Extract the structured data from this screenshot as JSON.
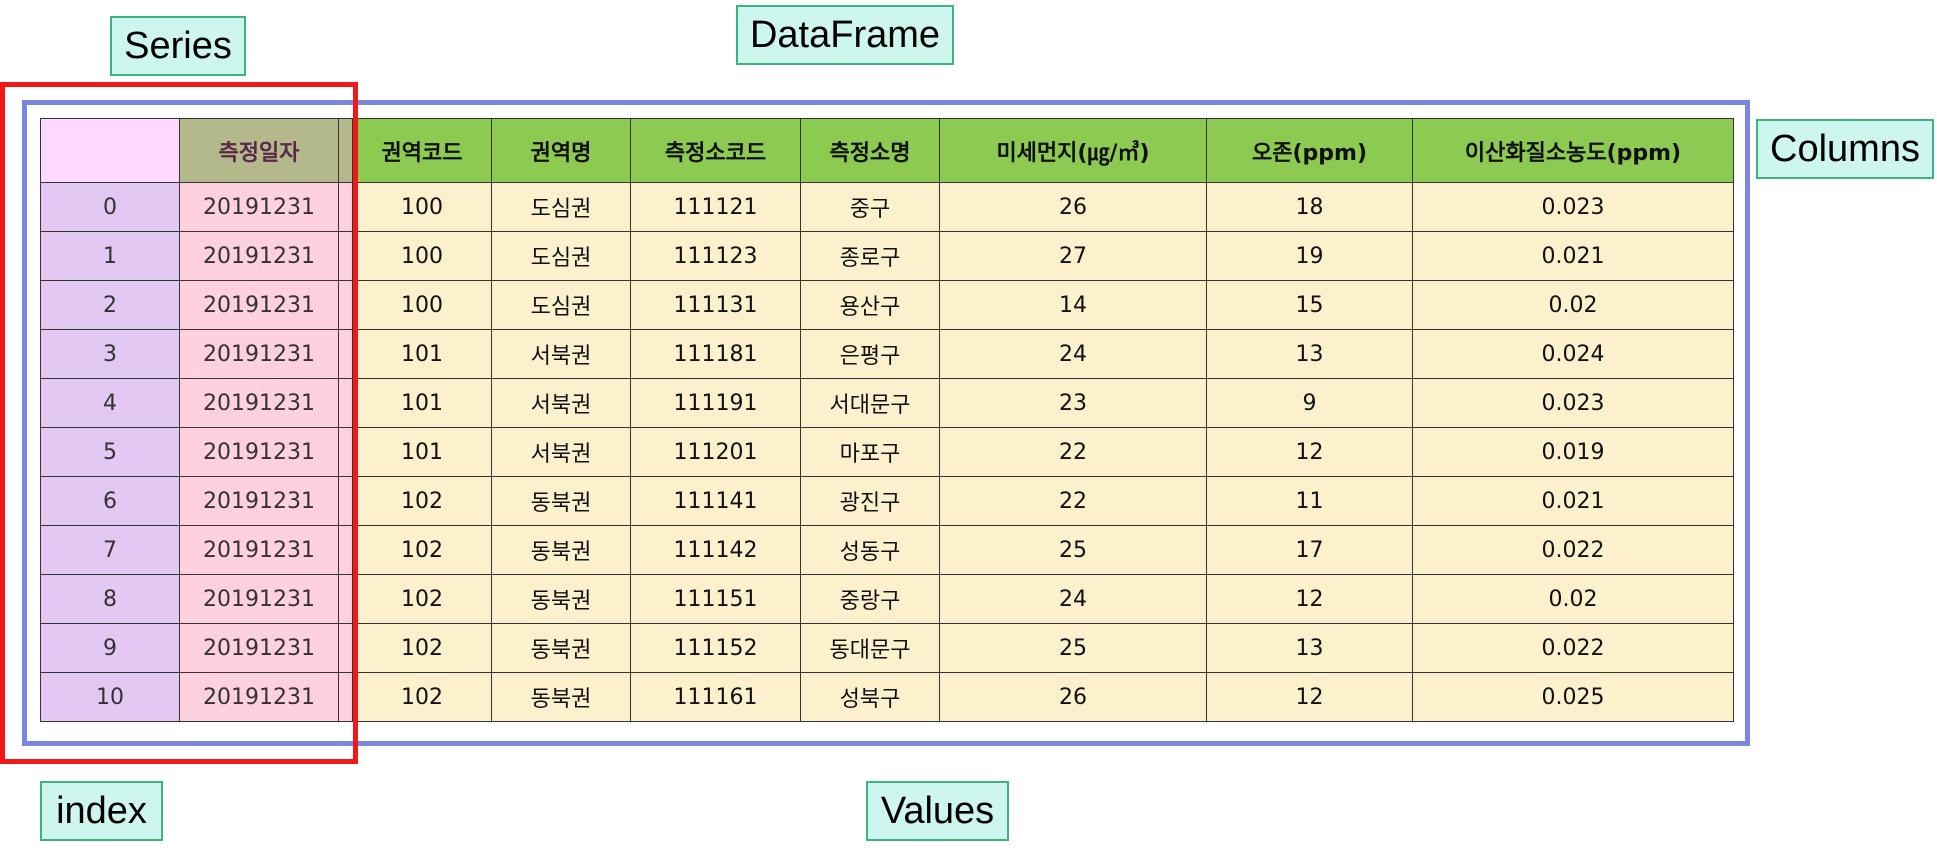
{
  "labels": {
    "series": "Series",
    "dataframe": "DataFrame",
    "columns": "Columns",
    "index": "index",
    "values": "Values"
  },
  "colors": {
    "label_bg": "#cdf6ee",
    "label_border": "#3cb47f",
    "dataframe_border": "#7b86e0",
    "series_border": "#f01818",
    "header_bg": "#8cca51",
    "values_bg": "#fdf1cd",
    "index_bg": "#e3c8f4",
    "series_bg": "#ffd1de"
  },
  "table": {
    "headers": [
      "측정일자",
      "권역코드",
      "권역명",
      "측정소코드",
      "측정소명",
      "미세먼지(㎍/㎥)",
      "오존(ppm)",
      "이산화질소농도(ppm)"
    ],
    "rows": [
      {
        "index": "0",
        "cells": [
          "20191231",
          "100",
          "도심권",
          "111121",
          "중구",
          "26",
          "18",
          "0.023"
        ]
      },
      {
        "index": "1",
        "cells": [
          "20191231",
          "100",
          "도심권",
          "111123",
          "종로구",
          "27",
          "19",
          "0.021"
        ]
      },
      {
        "index": "2",
        "cells": [
          "20191231",
          "100",
          "도심권",
          "111131",
          "용산구",
          "14",
          "15",
          "0.02"
        ]
      },
      {
        "index": "3",
        "cells": [
          "20191231",
          "101",
          "서북권",
          "111181",
          "은평구",
          "24",
          "13",
          "0.024"
        ]
      },
      {
        "index": "4",
        "cells": [
          "20191231",
          "101",
          "서북권",
          "111191",
          "서대문구",
          "23",
          "9",
          "0.023"
        ]
      },
      {
        "index": "5",
        "cells": [
          "20191231",
          "101",
          "서북권",
          "111201",
          "마포구",
          "22",
          "12",
          "0.019"
        ]
      },
      {
        "index": "6",
        "cells": [
          "20191231",
          "102",
          "동북권",
          "111141",
          "광진구",
          "22",
          "11",
          "0.021"
        ]
      },
      {
        "index": "7",
        "cells": [
          "20191231",
          "102",
          "동북권",
          "111142",
          "성동구",
          "25",
          "17",
          "0.022"
        ]
      },
      {
        "index": "8",
        "cells": [
          "20191231",
          "102",
          "동북권",
          "111151",
          "중랑구",
          "24",
          "12",
          "0.02"
        ]
      },
      {
        "index": "9",
        "cells": [
          "20191231",
          "102",
          "동북권",
          "111152",
          "동대문구",
          "25",
          "13",
          "0.022"
        ]
      },
      {
        "index": "10",
        "cells": [
          "20191231",
          "102",
          "동북권",
          "111161",
          "성북구",
          "26",
          "12",
          "0.025"
        ]
      }
    ]
  }
}
